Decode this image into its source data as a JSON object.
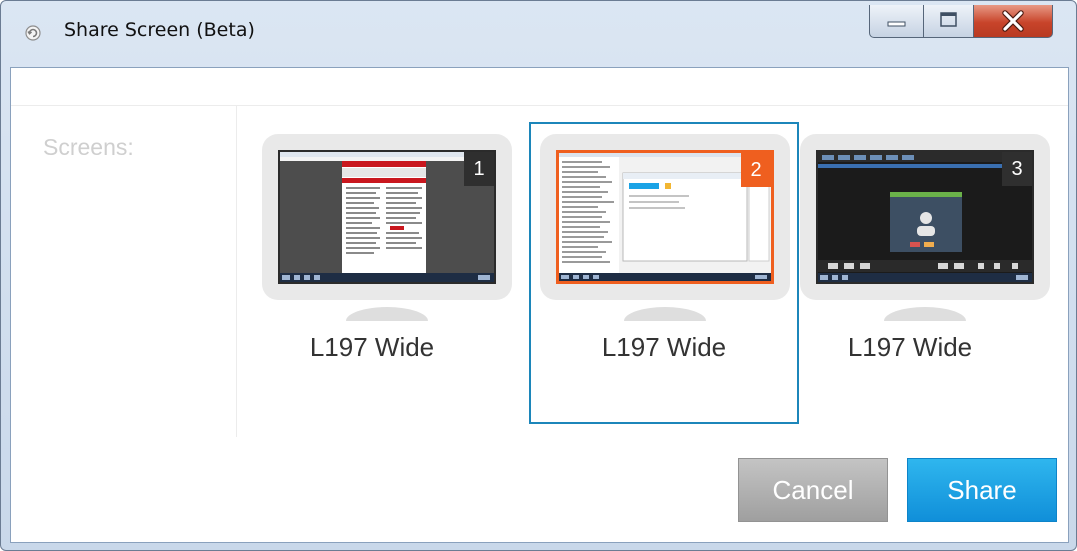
{
  "window": {
    "title": "Share Screen (Beta)",
    "controls": {
      "minimize": "minimize-icon",
      "maximize": "maximize-icon",
      "close": "close-icon"
    }
  },
  "sidebar": {
    "label": "Screens:"
  },
  "screens": [
    {
      "number": "1",
      "label": "L197 Wide",
      "selected": false
    },
    {
      "number": "2",
      "label": "L197 Wide",
      "selected": true
    },
    {
      "number": "3",
      "label": "L197 Wide",
      "selected": false
    }
  ],
  "buttons": {
    "cancel": "Cancel",
    "share": "Share"
  },
  "colors": {
    "accent": "#1aa3e6",
    "selection_border": "#1c86ba",
    "selected_badge": "#ef5f1f",
    "badge": "#2f2f2f",
    "cancel_button": "#a8a8a8"
  }
}
